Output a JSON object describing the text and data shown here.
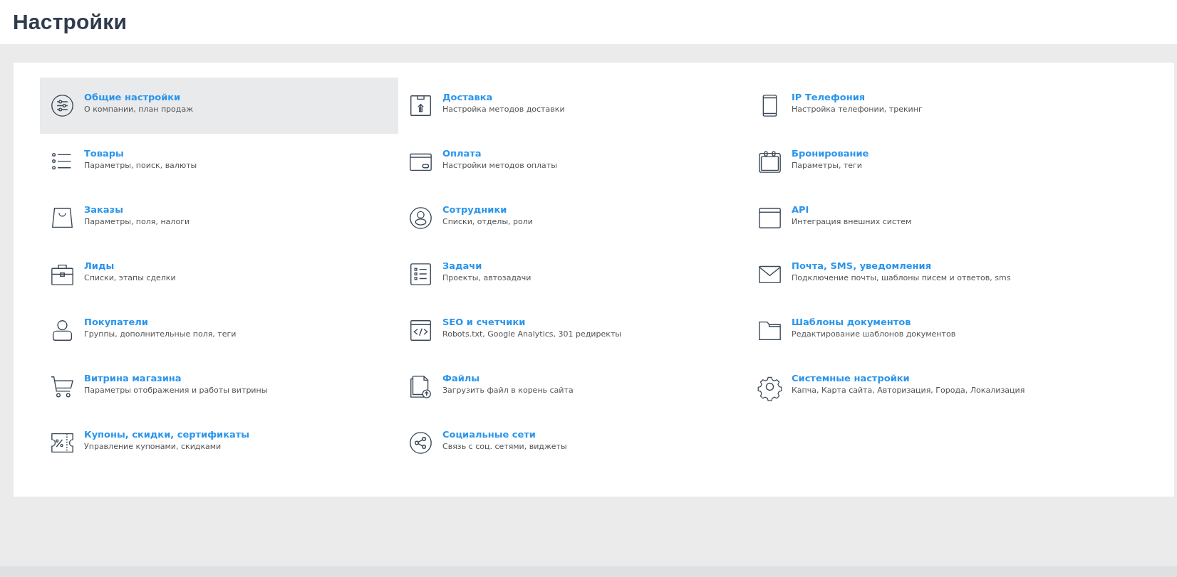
{
  "page_title": "Настройки",
  "items": [
    {
      "kind": "sliders",
      "title": "Общие настройки",
      "description": "О компании, план продаж",
      "selected": true
    },
    {
      "kind": "box",
      "title": "Доставка",
      "description": "Настройка методов доставки",
      "selected": false
    },
    {
      "kind": "phone",
      "title": "IP Телефония",
      "description": "Настройка телефонии, трекинг",
      "selected": false
    },
    {
      "kind": "list",
      "title": "Товары",
      "description": "Параметры, поиск, валюты",
      "selected": false
    },
    {
      "kind": "card",
      "title": "Оплата",
      "description": "Настройки методов оплаты",
      "selected": false
    },
    {
      "kind": "calendar",
      "title": "Бронирование",
      "description": "Параметры, теги",
      "selected": false
    },
    {
      "kind": "bag",
      "title": "Заказы",
      "description": "Параметры, поля, налоги",
      "selected": false
    },
    {
      "kind": "usercircle",
      "title": "Сотрудники",
      "description": "Списки, отделы, роли",
      "selected": false
    },
    {
      "kind": "window",
      "title": "API",
      "description": "Интеграция внешних систем",
      "selected": false
    },
    {
      "kind": "briefcase",
      "title": "Лиды",
      "description": "Списки, этапы сделки",
      "selected": false
    },
    {
      "kind": "checklist",
      "title": "Задачи",
      "description": "Проекты, автозадачи",
      "selected": false
    },
    {
      "kind": "envelope",
      "title": "Почта, SMS, уведомления",
      "description": "Подключение почты, шаблоны писем и ответов, sms",
      "selected": false
    },
    {
      "kind": "user",
      "title": "Покупатели",
      "description": "Группы, дополнительные поля, теги",
      "selected": false
    },
    {
      "kind": "code",
      "title": "SEO и счетчики",
      "description": "Robots.txt, Google Analytics, 301 редиректы",
      "selected": false
    },
    {
      "kind": "folder",
      "title": "Шаблоны документов",
      "description": "Редактирование шаблонов документов",
      "selected": false
    },
    {
      "kind": "cart",
      "title": "Витрина магазина",
      "description": "Параметры отображения и работы витрины",
      "selected": false
    },
    {
      "kind": "fileupload",
      "title": "Файлы",
      "description": "Загрузить файл в корень сайта",
      "selected": false
    },
    {
      "kind": "gear",
      "title": "Системные настройки",
      "description": "Капча, Карта сайта, Авторизация, Города, Локализация",
      "selected": false
    },
    {
      "kind": "coupon",
      "title": "Купоны, скидки, сертификаты",
      "description": "Управление купонами, скидками",
      "selected": false
    },
    {
      "kind": "share",
      "title": "Социальные сети",
      "description": "Связь с соц. сетями, виджеты",
      "selected": false
    }
  ]
}
